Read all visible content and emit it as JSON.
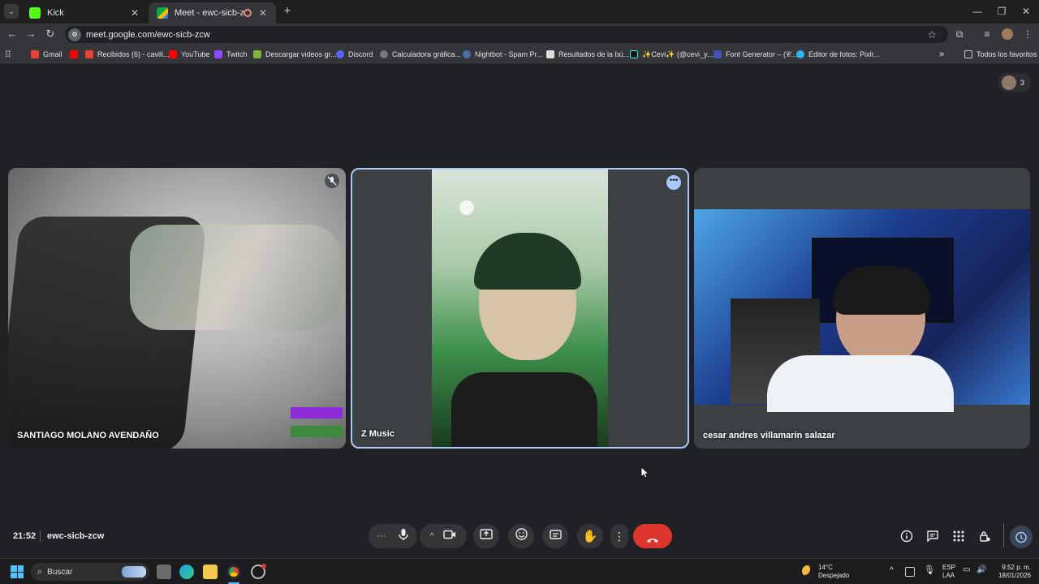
{
  "browser": {
    "tabs": [
      {
        "title": "Kick"
      },
      {
        "title": "Meet - ewc-sicb-zcw"
      }
    ],
    "address": "meet.google.com/ewc-sicb-zcw",
    "bookmarks": [
      {
        "label": "Gmail"
      },
      {
        "label": "Recibidos (6) - cavill..."
      },
      {
        "label": "YouTube"
      },
      {
        "label": "Twitch"
      },
      {
        "label": "Descargar videos gr..."
      },
      {
        "label": "Discord"
      },
      {
        "label": "Calculadora gráfica..."
      },
      {
        "label": "Nightbot - Spam Pr..."
      },
      {
        "label": "Resultados de la bú..."
      },
      {
        "label": "✨Cevi✨ (@cevi_y..."
      },
      {
        "label": "Font Generator – (𝒞..."
      },
      {
        "label": "Editor de fotos: Pixlr..."
      }
    ],
    "all_bookmarks": "Todos los favoritos"
  },
  "meet": {
    "participant_count": "3",
    "tiles": [
      {
        "name": "SANTIAGO MOLANO AVENDAÑO"
      },
      {
        "name": "Z Music"
      },
      {
        "name": "cesar andres villamarin salazar"
      }
    ],
    "clock": "21:52",
    "meeting_code": "ewc-sicb-zcw"
  },
  "taskbar": {
    "search_placeholder": "Buscar",
    "weather_temp": "14°C",
    "weather_desc": "Despejado",
    "lang_top": "ESP",
    "lang_bottom": "LAA",
    "time": "9:52 p. m.",
    "date": "18/01/2026"
  },
  "colors": {
    "accent": "#a8c7fa",
    "end_call": "#dc362e",
    "background": "#202124"
  }
}
